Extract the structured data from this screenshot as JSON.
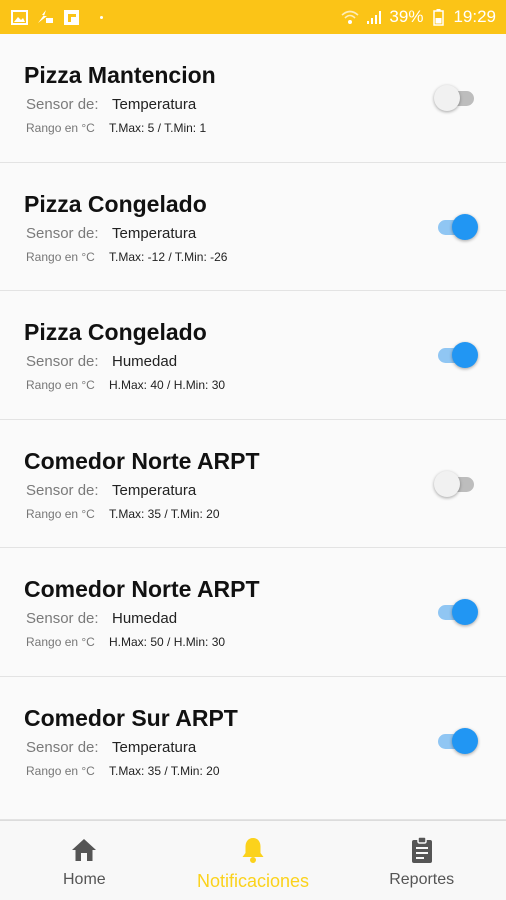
{
  "status_bar": {
    "battery": "39%",
    "time": "19:29",
    "icons": [
      "image-icon",
      "flash-icon",
      "flipboard-icon",
      "wifi-icon",
      "signal-icon",
      "battery-icon"
    ]
  },
  "cards": [
    {
      "title": "Pizza Mantencion",
      "sensor_label": "Sensor de:",
      "sensor": "Temperatura",
      "range_label": "Rango en °C",
      "range": "T.Max: 5 / T.Min: 1",
      "enabled": false
    },
    {
      "title": "Pizza Congelado",
      "sensor_label": "Sensor de:",
      "sensor": "Temperatura",
      "range_label": "Rango en °C",
      "range": "T.Max: -12 / T.Min: -26",
      "enabled": true
    },
    {
      "title": "Pizza Congelado",
      "sensor_label": "Sensor de:",
      "sensor": "Humedad",
      "range_label": "Rango en °C",
      "range": "H.Max: 40 / H.Min: 30",
      "enabled": true
    },
    {
      "title": "Comedor Norte ARPT",
      "sensor_label": "Sensor de:",
      "sensor": "Temperatura",
      "range_label": "Rango en °C",
      "range": "T.Max: 35 / T.Min: 20",
      "enabled": false
    },
    {
      "title": "Comedor Norte ARPT",
      "sensor_label": "Sensor de:",
      "sensor": "Humedad",
      "range_label": "Rango en °C",
      "range": "H.Max: 50 / H.Min: 30",
      "enabled": true
    },
    {
      "title": "Comedor Sur ARPT",
      "sensor_label": "Sensor de:",
      "sensor": "Temperatura",
      "range_label": "Rango en °C",
      "range": "T.Max: 35 / T.Min: 20",
      "enabled": true
    }
  ],
  "tabs": [
    {
      "label": "Home",
      "icon": "home-icon",
      "active": false
    },
    {
      "label": "Notificaciones",
      "icon": "bell-icon",
      "active": true
    },
    {
      "label": "Reportes",
      "icon": "clipboard-icon",
      "active": false
    }
  ],
  "colors": {
    "status_bar": "#fbc417",
    "active_tab": "#fbd21c",
    "toggle_on": "#2196f3",
    "toggle_on_track": "#90c6f3",
    "toggle_off_track": "#bdbdbd"
  }
}
